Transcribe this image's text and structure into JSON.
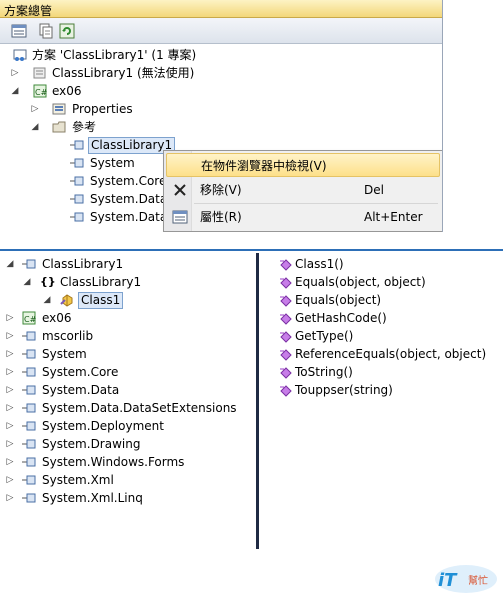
{
  "solution_explorer": {
    "title": "方案總管",
    "toolbar": [
      "properties-icon",
      "show-all-files-icon",
      "refresh-icon"
    ],
    "tree": [
      {
        "label": "方案 'ClassLibrary1' (1 專案)",
        "icon": "solution-icon",
        "expander": ""
      },
      {
        "label": "ClassLibrary1 (無法使用)",
        "icon": "unavailable-project-icon",
        "expander": "▷"
      },
      {
        "label": "ex06",
        "icon": "csharp-project-icon",
        "expander": "◢"
      },
      {
        "label": "Properties",
        "icon": "properties-folder-icon",
        "expander": "▷"
      },
      {
        "label": "參考",
        "icon": "references-folder-icon",
        "expander": "◢"
      },
      {
        "label": "ClassLibrary1",
        "icon": "reference-icon",
        "expander": ""
      },
      {
        "label": "System",
        "icon": "reference-icon",
        "expander": ""
      },
      {
        "label": "System.Core",
        "icon": "reference-icon",
        "expander": ""
      },
      {
        "label": "System.Data",
        "icon": "reference-icon",
        "expander": ""
      },
      {
        "label": "System.Data.",
        "icon": "reference-icon",
        "expander": ""
      }
    ]
  },
  "context_menu": {
    "items": [
      {
        "label": "在物件瀏覽器中檢視(V)",
        "shortcut": "",
        "icon": ""
      },
      {
        "label": "移除(V)",
        "shortcut": "Del",
        "icon": "remove-x-icon"
      },
      {
        "label": "屬性(R)",
        "shortcut": "Alt+Enter",
        "icon": "properties-icon"
      }
    ]
  },
  "object_browser": {
    "tree": [
      {
        "label": "ClassLibrary1",
        "icon": "assembly-icon",
        "expander": "◢"
      },
      {
        "label": "ClassLibrary1",
        "icon": "namespace-icon",
        "expander": "◢"
      },
      {
        "label": "Class1",
        "icon": "class-icon",
        "expander": "◢"
      },
      {
        "label": "ex06",
        "icon": "csharp-project-icon",
        "expander": "▷"
      },
      {
        "label": "mscorlib",
        "icon": "assembly-icon",
        "expander": "▷"
      },
      {
        "label": "System",
        "icon": "assembly-icon",
        "expander": "▷"
      },
      {
        "label": "System.Core",
        "icon": "assembly-icon",
        "expander": "▷"
      },
      {
        "label": "System.Data",
        "icon": "assembly-icon",
        "expander": "▷"
      },
      {
        "label": "System.Data.DataSetExtensions",
        "icon": "assembly-icon",
        "expander": "▷"
      },
      {
        "label": "System.Deployment",
        "icon": "assembly-icon",
        "expander": "▷"
      },
      {
        "label": "System.Drawing",
        "icon": "assembly-icon",
        "expander": "▷"
      },
      {
        "label": "System.Windows.Forms",
        "icon": "assembly-icon",
        "expander": "▷"
      },
      {
        "label": "System.Xml",
        "icon": "assembly-icon",
        "expander": "▷"
      },
      {
        "label": "System.Xml.Linq",
        "icon": "assembly-icon",
        "expander": "▷"
      }
    ],
    "members": [
      "Class1()",
      "Equals(object, object)",
      "Equals(object)",
      "GetHashCode()",
      "GetType()",
      "ReferenceEquals(object, object)",
      "ToString()",
      "Touppser(string)"
    ]
  },
  "watermark": {
    "text_big": "iT",
    "text_small": "幫忙"
  },
  "colors": {
    "title_bar": "#f3d77a",
    "selection": "#dce8f8",
    "menu_highlight": "#fde08a",
    "method_icon": "#9b3cc8",
    "divider": "#2d6fb7"
  }
}
